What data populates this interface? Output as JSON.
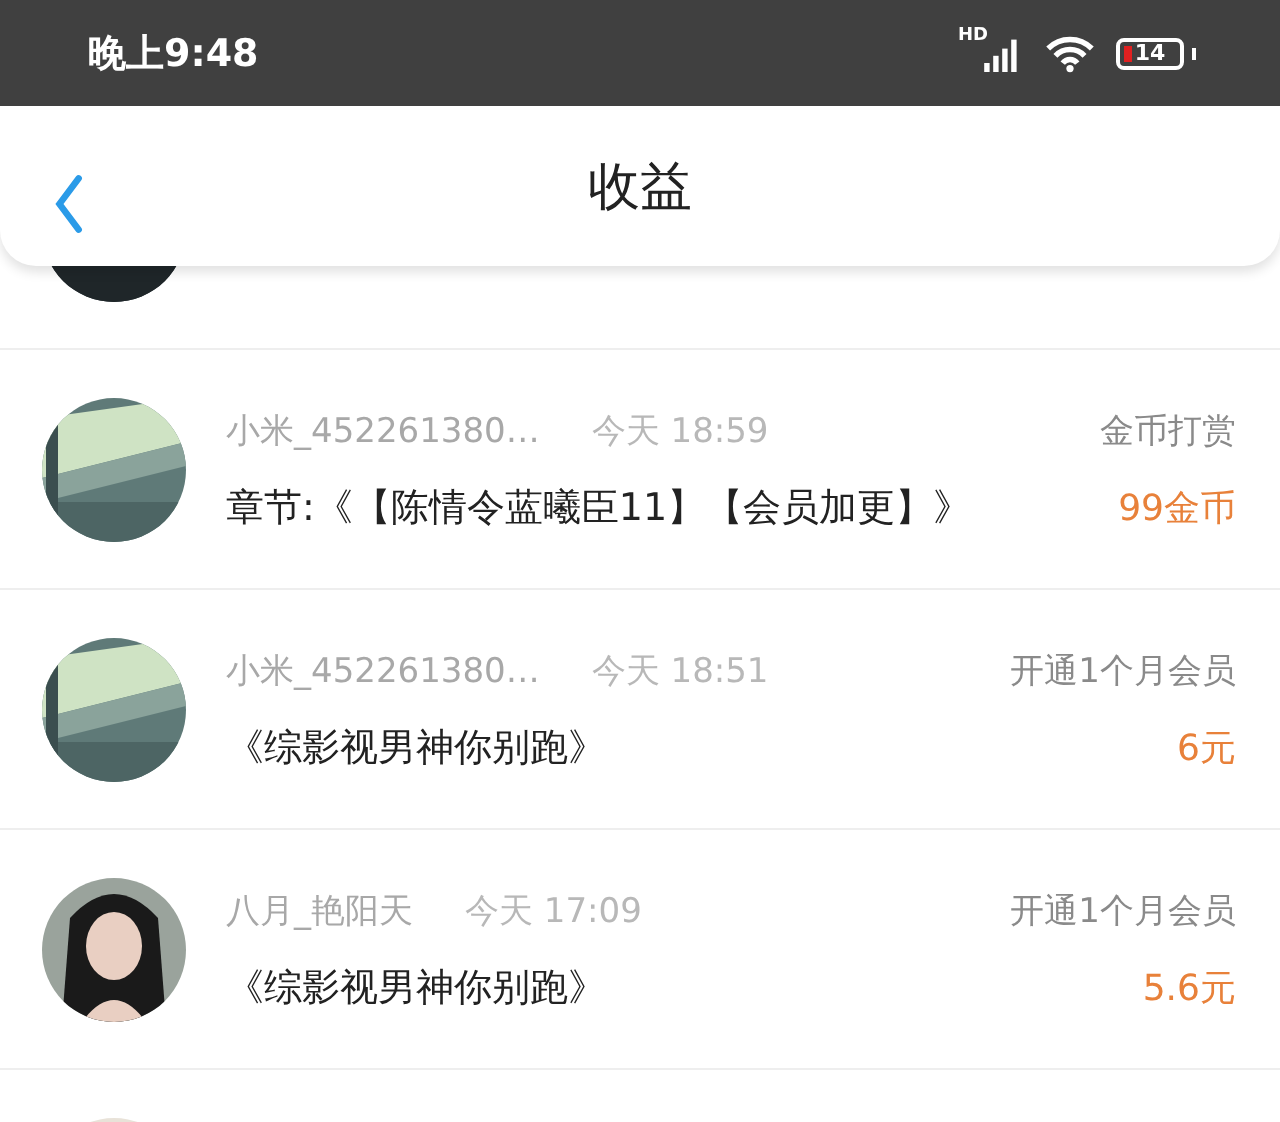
{
  "status_bar": {
    "time": "晚上9:48",
    "network": "HD",
    "battery": "14"
  },
  "header": {
    "title": "收益"
  },
  "rows": [
    {
      "kind": "covered"
    },
    {
      "kind": "entry",
      "name": "小米_452261380…",
      "time": "今天 18:59",
      "title": "章节:《【陈情令蓝曦臣11】【会员加更】》",
      "type": "金币打赏",
      "amount": "99金币"
    },
    {
      "kind": "entry",
      "name": "小米_452261380…",
      "time": "今天 18:51",
      "title": "《综影视男神你别跑》",
      "type": "开通1个月会员",
      "amount": "6元"
    },
    {
      "kind": "entry",
      "name": "八月_艳阳天",
      "time": "今天 17:09",
      "title": "《综影视男神你别跑》",
      "type": "开通1个月会员",
      "amount": "5.6元"
    },
    {
      "kind": "covered"
    }
  ]
}
